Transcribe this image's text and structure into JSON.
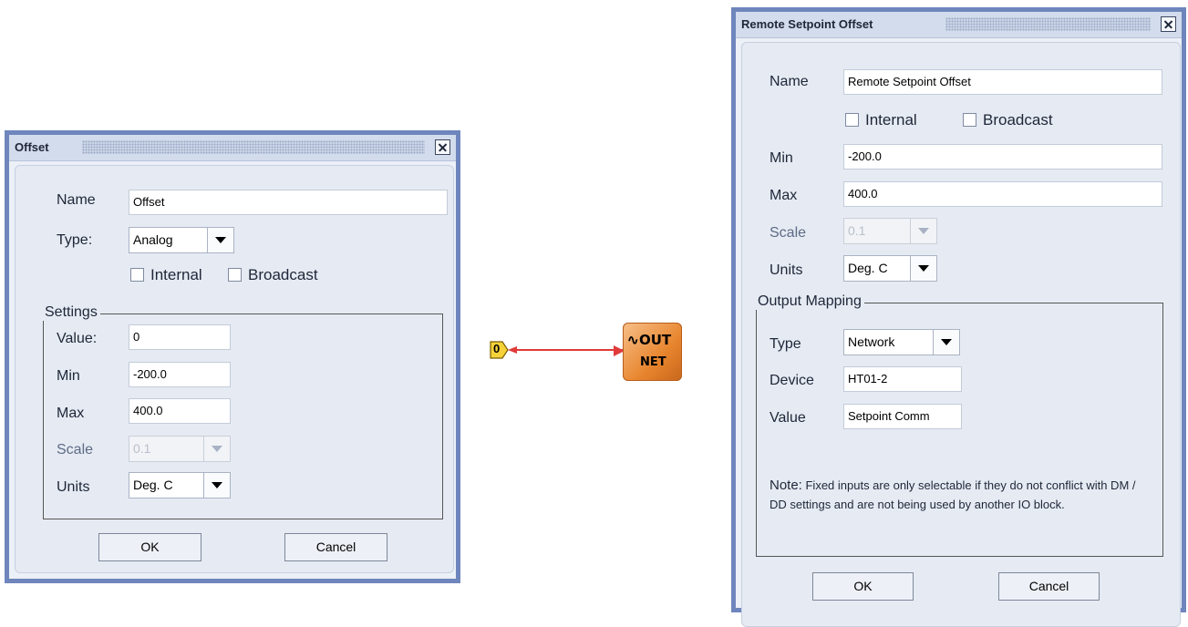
{
  "offset_dialog": {
    "title": "Offset",
    "name_label": "Name",
    "name_value": "Offset",
    "type_label": "Type:",
    "type_value": "Analog",
    "internal_label": "Internal",
    "broadcast_label": "Broadcast",
    "settings": {
      "legend": "Settings",
      "value_label": "Value:",
      "value": "0",
      "min_label": "Min",
      "min": "-200.0",
      "max_label": "Max",
      "max": "400.0",
      "scale_label": "Scale",
      "scale": "0.1",
      "units_label": "Units",
      "units": "Deg. C"
    },
    "ok_label": "OK",
    "cancel_label": "Cancel"
  },
  "canvas": {
    "input_tag": "0",
    "out_block_top": "OUT",
    "out_block_bottom": "NET",
    "wire_color": "#e03a3a"
  },
  "remote_dialog": {
    "title": "Remote Setpoint Offset",
    "name_label": "Name",
    "name_value": "Remote Setpoint Offset",
    "internal_label": "Internal",
    "broadcast_label": "Broadcast",
    "min_label": "Min",
    "min": "-200.0",
    "max_label": "Max",
    "max": "400.0",
    "scale_label": "Scale",
    "scale": "0.1",
    "units_label": "Units",
    "units": "Deg. C",
    "output_mapping": {
      "legend": "Output Mapping",
      "type_label": "Type",
      "type_value": "Network",
      "device_label": "Device",
      "device": "HT01-2",
      "value_label": "Value",
      "value": "Setpoint Comm"
    },
    "note_prefix": "Note:",
    "note_text": "Fixed inputs are only selectable if they do not conflict with DM / DD settings and are not being used by another IO block.",
    "ok_label": "OK",
    "cancel_label": "Cancel"
  },
  "colors": {
    "dialog_border": "#6f86bd",
    "titlebar": "#d3dcec",
    "panel": "#e6ebf3",
    "out_block": "#e8862f"
  }
}
